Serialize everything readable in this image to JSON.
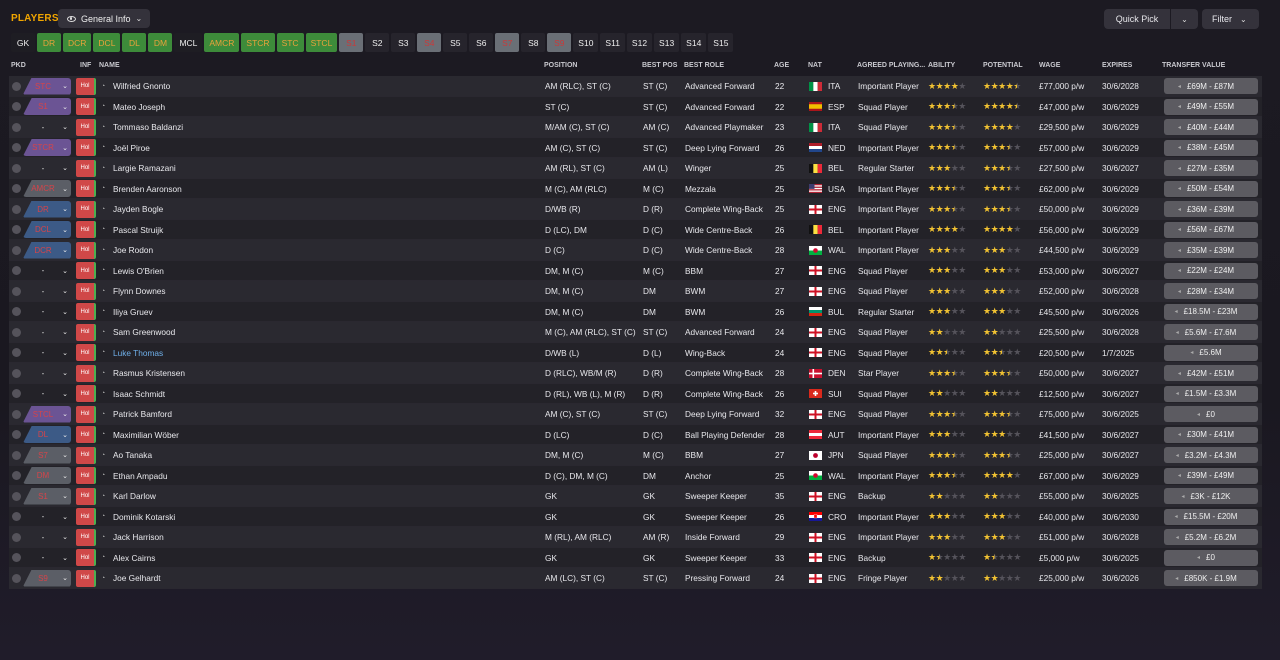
{
  "header": {
    "title": "PLAYERS",
    "view": "General Info",
    "quick_pick": "Quick Pick",
    "filter": "Filter"
  },
  "position_filters": [
    {
      "label": "GK",
      "state": "dark"
    },
    {
      "label": "DR",
      "state": "green"
    },
    {
      "label": "DCR",
      "state": "green"
    },
    {
      "label": "DCL",
      "state": "green"
    },
    {
      "label": "DL",
      "state": "green"
    },
    {
      "label": "DM",
      "state": "green"
    },
    {
      "label": "MCL",
      "state": "dark"
    },
    {
      "label": "AMCR",
      "state": "green"
    },
    {
      "label": "STCR",
      "state": "green"
    },
    {
      "label": "STC",
      "state": "green"
    },
    {
      "label": "STCL",
      "state": "green"
    },
    {
      "label": "S1",
      "state": "red"
    },
    {
      "label": "S2",
      "state": "plain"
    },
    {
      "label": "S3",
      "state": "plain"
    },
    {
      "label": "S4",
      "state": "red"
    },
    {
      "label": "S5",
      "state": "plain"
    },
    {
      "label": "S6",
      "state": "plain"
    },
    {
      "label": "S7",
      "state": "red"
    },
    {
      "label": "S8",
      "state": "plain"
    },
    {
      "label": "S9",
      "state": "red"
    },
    {
      "label": "S10",
      "state": "plain"
    },
    {
      "label": "S11",
      "state": "plain"
    },
    {
      "label": "S12",
      "state": "plain"
    },
    {
      "label": "S13",
      "state": "plain"
    },
    {
      "label": "S14",
      "state": "plain"
    },
    {
      "label": "S15",
      "state": "plain"
    }
  ],
  "columns": {
    "pkd": "PKD",
    "inf": "INF",
    "name": "NAME",
    "position": "POSITION",
    "best_pos": "BEST POS",
    "best_role": "BEST ROLE",
    "age": "AGE",
    "nat": "NAT",
    "agreed": "AGREED PLAYING...",
    "ability": "ABILITY",
    "potential": "POTENTIAL",
    "wage": "WAGE",
    "expires": "EXPIRES",
    "transfer_value": "TRANSFER VALUE"
  },
  "inf_label": "Hol",
  "players": [
    {
      "pkd": "STC",
      "pkd_color": "purple",
      "name": "Wilfried Gnonto",
      "position": "AM (RLC), ST (C)",
      "best_pos": "ST (C)",
      "best_role": "Advanced Forward",
      "age": "22",
      "nat": "ITA",
      "flag": "ITA",
      "agreed": "Important Player",
      "ability": 4.0,
      "potential": 4.5,
      "wage": "£77,000 p/w",
      "expires": "30/6/2028",
      "tv": "£69M - £87M"
    },
    {
      "pkd": "S1",
      "pkd_color": "purple",
      "name": "Mateo Joseph",
      "position": "ST (C)",
      "best_pos": "ST (C)",
      "best_role": "Advanced Forward",
      "age": "22",
      "nat": "ESP",
      "flag": "ESP",
      "agreed": "Squad Player",
      "ability": 3.5,
      "potential": 4.5,
      "wage": "£47,000 p/w",
      "expires": "30/6/2029",
      "tv": "£49M - £55M"
    },
    {
      "pkd": "-",
      "pkd_color": "none",
      "name": "Tommaso Baldanzi",
      "position": "M/AM (C), ST (C)",
      "best_pos": "AM (C)",
      "best_role": "Advanced Playmaker",
      "age": "23",
      "nat": "ITA",
      "flag": "ITA",
      "agreed": "Squad Player",
      "ability": 3.5,
      "potential": 4.0,
      "wage": "£29,500 p/w",
      "expires": "30/6/2029",
      "tv": "£40M - £44M"
    },
    {
      "pkd": "STCR",
      "pkd_color": "purple",
      "name": "Joël Piroe",
      "position": "AM (C), ST (C)",
      "best_pos": "ST (C)",
      "best_role": "Deep Lying Forward",
      "age": "26",
      "nat": "NED",
      "flag": "NED",
      "agreed": "Important Player",
      "ability": 3.5,
      "potential": 3.5,
      "wage": "£57,000 p/w",
      "expires": "30/6/2029",
      "tv": "£38M - £45M"
    },
    {
      "pkd": "-",
      "pkd_color": "none",
      "name": "Largie Ramazani",
      "position": "AM (RL), ST (C)",
      "best_pos": "AM (L)",
      "best_role": "Winger",
      "age": "25",
      "nat": "BEL",
      "flag": "BEL",
      "agreed": "Regular Starter",
      "ability": 3.0,
      "potential": 3.5,
      "wage": "£27,500 p/w",
      "expires": "30/6/2027",
      "tv": "£27M - £35M"
    },
    {
      "pkd": "AMCR",
      "pkd_color": "gray",
      "name": "Brenden Aaronson",
      "position": "M (C), AM (RLC)",
      "best_pos": "M (C)",
      "best_role": "Mezzala",
      "age": "25",
      "nat": "USA",
      "flag": "USA",
      "agreed": "Important Player",
      "ability": 3.5,
      "potential": 3.5,
      "wage": "£62,000 p/w",
      "expires": "30/6/2029",
      "tv": "£50M - £54M"
    },
    {
      "pkd": "DR",
      "pkd_color": "blue",
      "name": "Jayden Bogle",
      "position": "D/WB (R)",
      "best_pos": "D (R)",
      "best_role": "Complete Wing-Back",
      "age": "25",
      "nat": "ENG",
      "flag": "ENG",
      "agreed": "Important Player",
      "ability": 3.5,
      "potential": 3.5,
      "wage": "£50,000 p/w",
      "expires": "30/6/2029",
      "tv": "£36M - £39M"
    },
    {
      "pkd": "DCL",
      "pkd_color": "blue",
      "name": "Pascal Struijk",
      "position": "D (LC), DM",
      "best_pos": "D (C)",
      "best_role": "Wide Centre-Back",
      "age": "26",
      "nat": "BEL",
      "flag": "BEL",
      "agreed": "Important Player",
      "ability": 4.0,
      "potential": 4.0,
      "wage": "£56,000 p/w",
      "expires": "30/6/2029",
      "tv": "£56M - £67M"
    },
    {
      "pkd": "DCR",
      "pkd_color": "blue",
      "name": "Joe Rodon",
      "position": "D (C)",
      "best_pos": "D (C)",
      "best_role": "Wide Centre-Back",
      "age": "28",
      "nat": "WAL",
      "flag": "WAL",
      "agreed": "Important Player",
      "ability": 3.0,
      "potential": 3.0,
      "wage": "£44,500 p/w",
      "expires": "30/6/2029",
      "tv": "£35M - £39M"
    },
    {
      "pkd": "-",
      "pkd_color": "none",
      "name": "Lewis O'Brien",
      "position": "DM, M (C)",
      "best_pos": "M (C)",
      "best_role": "BBM",
      "age": "27",
      "nat": "ENG",
      "flag": "ENG",
      "agreed": "Squad Player",
      "ability": 3.0,
      "potential": 3.0,
      "wage": "£53,000 p/w",
      "expires": "30/6/2027",
      "tv": "£22M - £24M"
    },
    {
      "pkd": "-",
      "pkd_color": "none",
      "name": "Flynn Downes",
      "position": "DM, M (C)",
      "best_pos": "DM",
      "best_role": "BWM",
      "age": "27",
      "nat": "ENG",
      "flag": "ENG",
      "agreed": "Squad Player",
      "ability": 3.0,
      "potential": 3.0,
      "wage": "£52,000 p/w",
      "expires": "30/6/2028",
      "tv": "£28M - £34M"
    },
    {
      "pkd": "-",
      "pkd_color": "none",
      "name": "Iliya Gruev",
      "position": "DM, M (C)",
      "best_pos": "DM",
      "best_role": "BWM",
      "age": "26",
      "nat": "BUL",
      "flag": "BUL",
      "agreed": "Regular Starter",
      "ability": 3.0,
      "potential": 3.0,
      "wage": "£45,500 p/w",
      "expires": "30/6/2026",
      "tv": "£18.5M - £23M"
    },
    {
      "pkd": "-",
      "pkd_color": "none",
      "name": "Sam Greenwood",
      "position": "M (C), AM (RLC), ST (C)",
      "best_pos": "ST (C)",
      "best_role": "Advanced Forward",
      "age": "24",
      "nat": "ENG",
      "flag": "ENG",
      "agreed": "Squad Player",
      "ability": 2.0,
      "potential": 2.0,
      "wage": "£25,500 p/w",
      "expires": "30/6/2028",
      "tv": "£5.6M - £7.6M"
    },
    {
      "pkd": "-",
      "pkd_color": "none",
      "name": "Luke Thomas",
      "link": true,
      "position": "D/WB (L)",
      "best_pos": "D (L)",
      "best_role": "Wing-Back",
      "age": "24",
      "nat": "ENG",
      "flag": "ENG",
      "agreed": "Squad Player",
      "ability": 2.5,
      "potential": 2.5,
      "wage": "£20,500 p/w",
      "expires": "1/7/2025",
      "tv": "£5.6M"
    },
    {
      "pkd": "-",
      "pkd_color": "none",
      "name": "Rasmus Kristensen",
      "position": "D (RLC), WB/M (R)",
      "best_pos": "D (R)",
      "best_role": "Complete Wing-Back",
      "age": "28",
      "nat": "DEN",
      "flag": "DEN",
      "agreed": "Star Player",
      "ability": 3.5,
      "potential": 3.5,
      "wage": "£50,000 p/w",
      "expires": "30/6/2027",
      "tv": "£42M - £51M"
    },
    {
      "pkd": "-",
      "pkd_color": "none",
      "name": "Isaac Schmidt",
      "position": "D (RL), WB (L), M (R)",
      "best_pos": "D (R)",
      "best_role": "Complete Wing-Back",
      "age": "26",
      "nat": "SUI",
      "flag": "SUI",
      "agreed": "Squad Player",
      "ability": 2.0,
      "potential": 2.0,
      "wage": "£12,500 p/w",
      "expires": "30/6/2027",
      "tv": "£1.5M - £3.3M"
    },
    {
      "pkd": "STCL",
      "pkd_color": "purple",
      "name": "Patrick Bamford",
      "position": "AM (C), ST (C)",
      "best_pos": "ST (C)",
      "best_role": "Deep Lying Forward",
      "age": "32",
      "nat": "ENG",
      "flag": "ENG",
      "agreed": "Squad Player",
      "ability": 3.5,
      "potential": 3.5,
      "wage": "£75,000 p/w",
      "expires": "30/6/2025",
      "tv": "£0"
    },
    {
      "pkd": "DL",
      "pkd_color": "blue",
      "name": "Maximilian Wöber",
      "position": "D (LC)",
      "best_pos": "D (C)",
      "best_role": "Ball Playing Defender",
      "age": "28",
      "nat": "AUT",
      "flag": "AUT",
      "agreed": "Important Player",
      "ability": 3.0,
      "potential": 3.0,
      "wage": "£41,500 p/w",
      "expires": "30/6/2027",
      "tv": "£30M - £41M"
    },
    {
      "pkd": "S7",
      "pkd_color": "gray",
      "name": "Ao Tanaka",
      "position": "DM, M (C)",
      "best_pos": "M (C)",
      "best_role": "BBM",
      "age": "27",
      "nat": "JPN",
      "flag": "JPN",
      "agreed": "Squad Player",
      "ability": 3.5,
      "potential": 3.5,
      "wage": "£25,000 p/w",
      "expires": "30/6/2027",
      "tv": "£3.2M - £4.3M"
    },
    {
      "pkd": "DM",
      "pkd_color": "gray",
      "name": "Ethan Ampadu",
      "position": "D (C), DM, M (C)",
      "best_pos": "DM",
      "best_role": "Anchor",
      "age": "25",
      "nat": "WAL",
      "flag": "WAL",
      "agreed": "Important Player",
      "ability": 3.5,
      "potential": 4.0,
      "wage": "£67,000 p/w",
      "expires": "30/6/2029",
      "tv": "£39M - £49M"
    },
    {
      "pkd": "S1",
      "pkd_color": "gray",
      "name": "Karl Darlow",
      "position": "GK",
      "best_pos": "GK",
      "best_role": "Sweeper Keeper",
      "age": "35",
      "nat": "ENG",
      "flag": "ENG",
      "agreed": "Backup",
      "ability": 2.0,
      "potential": 2.0,
      "wage": "£55,000 p/w",
      "expires": "30/6/2025",
      "tv": "£3K - £12K"
    },
    {
      "pkd": "-",
      "pkd_color": "none",
      "name": "Dominik Kotarski",
      "position": "GK",
      "best_pos": "GK",
      "best_role": "Sweeper Keeper",
      "age": "26",
      "nat": "CRO",
      "flag": "CRO",
      "agreed": "Important Player",
      "ability": 3.0,
      "potential": 3.0,
      "wage": "£40,000 p/w",
      "expires": "30/6/2030",
      "tv": "£15.5M - £20M"
    },
    {
      "pkd": "-",
      "pkd_color": "none",
      "name": "Jack Harrison",
      "position": "M (RL), AM (RLC)",
      "best_pos": "AM (R)",
      "best_role": "Inside Forward",
      "age": "29",
      "nat": "ENG",
      "flag": "ENG",
      "agreed": "Important Player",
      "ability": 3.0,
      "potential": 3.0,
      "wage": "£51,000 p/w",
      "expires": "30/6/2028",
      "tv": "£5.2M - £6.2M"
    },
    {
      "pkd": "-",
      "pkd_color": "none",
      "name": "Alex Cairns",
      "position": "GK",
      "best_pos": "GK",
      "best_role": "Sweeper Keeper",
      "age": "33",
      "nat": "ENG",
      "flag": "ENG",
      "agreed": "Backup",
      "ability": 1.5,
      "potential": 1.5,
      "wage": "£5,000 p/w",
      "expires": "30/6/2025",
      "tv": "£0"
    },
    {
      "pkd": "S9",
      "pkd_color": "gray",
      "name": "Joe Gelhardt",
      "position": "AM (LC), ST (C)",
      "best_pos": "ST (C)",
      "best_role": "Pressing Forward",
      "age": "24",
      "nat": "ENG",
      "flag": "ENG",
      "agreed": "Fringe Player",
      "ability": 2.0,
      "potential": 2.0,
      "wage": "£25,000 p/w",
      "expires": "30/6/2026",
      "tv": "£850K - £1.9M"
    }
  ]
}
